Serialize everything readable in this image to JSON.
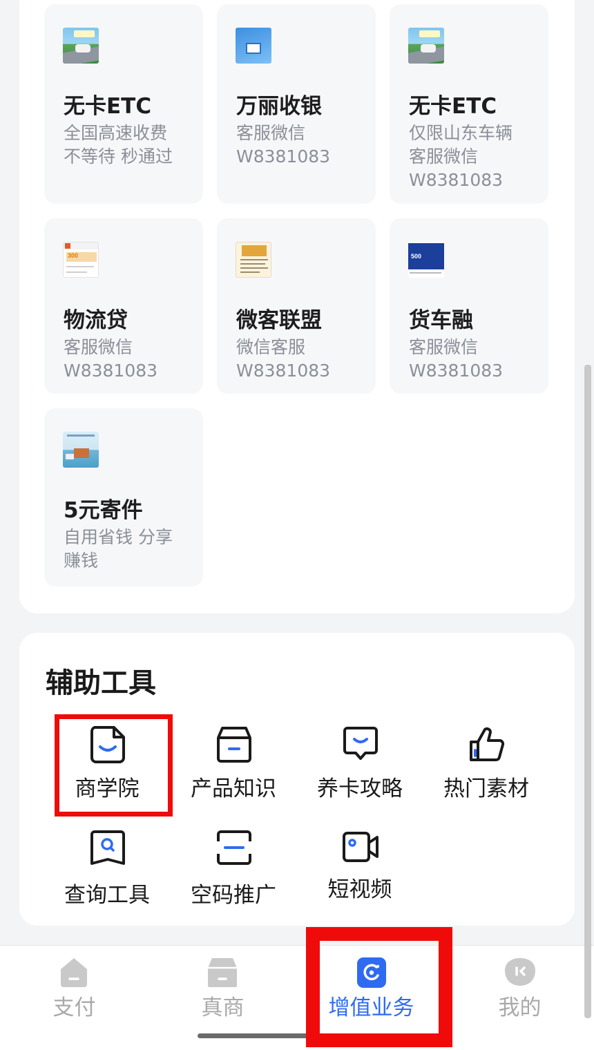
{
  "services": [
    {
      "title": "无卡ETC",
      "desc": "全国高速收费\n不等待 秒通过",
      "thumb": "etc-highway-image"
    },
    {
      "title": "万丽收银",
      "desc": "客服微信\nW8381083",
      "thumb": "qr-payment-image"
    },
    {
      "title": "无卡ETC",
      "desc": "仅限山东车辆\n客服微信\nW8381083",
      "thumb": "etc-highway-image"
    },
    {
      "title": "物流贷",
      "desc": "客服微信\nW8381083",
      "thumb": "loan-300-image"
    },
    {
      "title": "微客联盟",
      "desc": "微信客服\nW8381083",
      "thumb": "poster-image"
    },
    {
      "title": "货车融",
      "desc": "客服微信\nW8381083",
      "thumb": "loan-500-image"
    },
    {
      "title": "5元寄件",
      "desc": "自用省钱 分享\n赚钱",
      "thumb": "shipping-image"
    }
  ],
  "tools": {
    "title": "辅助工具",
    "items": [
      {
        "label": "商学院",
        "icon": "document-smile-icon"
      },
      {
        "label": "产品知识",
        "icon": "box-icon"
      },
      {
        "label": "养卡攻略",
        "icon": "chat-bubble-icon"
      },
      {
        "label": "热门素材",
        "icon": "thumbs-up-icon"
      },
      {
        "label": "查询工具",
        "icon": "search-doc-icon"
      },
      {
        "label": "空码推广",
        "icon": "scan-frame-icon"
      },
      {
        "label": "短视频",
        "icon": "video-camera-icon"
      }
    ]
  },
  "nav": {
    "items": [
      {
        "label": "支付",
        "icon": "home-icon",
        "active": false
      },
      {
        "label": "真商",
        "icon": "store-icon",
        "active": false
      },
      {
        "label": "增值业务",
        "icon": "value-added-icon",
        "active": true
      },
      {
        "label": "我的",
        "icon": "profile-icon",
        "active": false
      }
    ]
  },
  "colors": {
    "accent": "#2f6bf0",
    "highlight": "#f00b0b",
    "inactive": "#a9a9a9",
    "card_bg": "#f6f7f9"
  }
}
